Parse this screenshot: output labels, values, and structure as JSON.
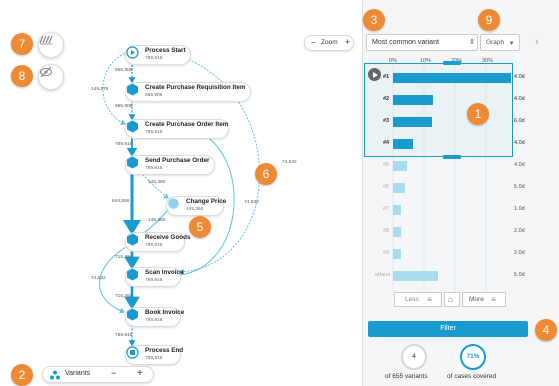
{
  "graph": {
    "nodes": [
      {
        "name": "Process Start",
        "count": "789,916"
      },
      {
        "name": "Create Purchase Requisition Item",
        "count": "565,908"
      },
      {
        "name": "Create Purchase Order Item",
        "count": "789,916"
      },
      {
        "name": "Send Purchase Order",
        "count": "789,916"
      },
      {
        "name": "Change Price",
        "count": "145,360"
      },
      {
        "name": "Receive Goods",
        "count": "789,916"
      },
      {
        "name": "Scan Invoice",
        "count": "789,916"
      },
      {
        "name": "Book Invoice",
        "count": "789,916"
      },
      {
        "name": "Process End",
        "count": "789,916"
      }
    ],
    "edge_labels": [
      "565,908",
      "149,376",
      "565,908",
      "789,916",
      "145,360",
      "644,556",
      "145,360",
      "715,284",
      "74,632",
      "74,632",
      "715,284",
      "789,916",
      "74,632"
    ],
    "zoom": {
      "label": "Zoom",
      "minus": "−",
      "plus": "+"
    }
  },
  "variants_control": {
    "label": "Variants",
    "minus": "−",
    "plus": "+"
  },
  "tools": [
    {
      "name": "filter-lines-icon",
      "symbol": "////"
    },
    {
      "name": "hide-icon",
      "symbol": "eye-slash"
    }
  ],
  "callouts": [
    "1",
    "2",
    "3",
    "4",
    "5",
    "6",
    "7",
    "8",
    "9"
  ],
  "panel": {
    "sort_select": {
      "value": "Most common variant",
      "arrow": "⇕"
    },
    "view_button": {
      "label": "Graph",
      "arrow": "▾"
    },
    "collapse_arrow": "›",
    "axis_ticks": [
      "0%",
      "10%",
      "20%",
      "30%"
    ],
    "variants": [
      {
        "label": "#1",
        "pct": 38,
        "duration": "4.0d"
      },
      {
        "label": "#2",
        "pct": 13,
        "duration": "4.0d"
      },
      {
        "label": "#3",
        "pct": 12.5,
        "duration": "6.0d"
      },
      {
        "label": "#4",
        "pct": 6.5,
        "duration": "4.0d"
      },
      {
        "label": "#5",
        "pct": 4.5,
        "duration": "4.0d"
      },
      {
        "label": "#6",
        "pct": 4.0,
        "duration": "5.0d"
      },
      {
        "label": "#7",
        "pct": 2.5,
        "duration": "1.0d"
      },
      {
        "label": "#8",
        "pct": 2.5,
        "duration": "2.0d"
      },
      {
        "label": "#9",
        "pct": 2.5,
        "duration": "2.0d"
      },
      {
        "label": "others",
        "pct": 14.5,
        "duration": "5.0d"
      }
    ],
    "less_label": "Less",
    "more_label": "More",
    "filter_label": "Filter",
    "variants_count": "4",
    "variants_caption": "of 655 variants",
    "cases_pct": "71%",
    "cases_caption": "of cases covered"
  },
  "colors": {
    "accent": "#1a9bd0",
    "callout": "#ee8a33",
    "node": "#1a9bd0"
  }
}
